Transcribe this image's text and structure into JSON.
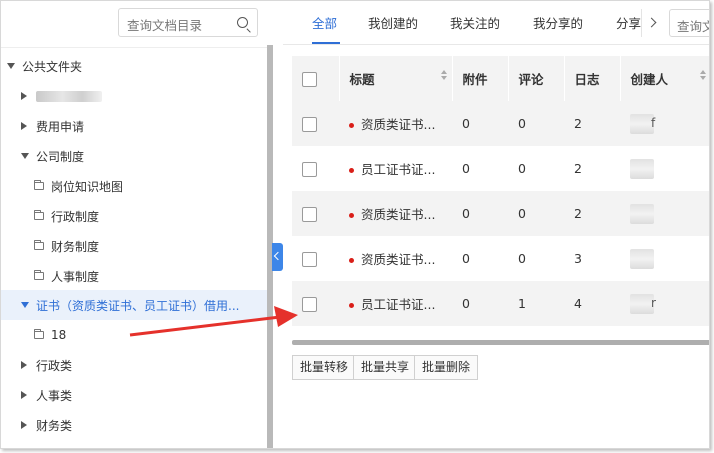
{
  "left_panel": {
    "search_placeholder": "查询文档目录",
    "tree": [
      {
        "label": "公共文件夹",
        "type": "expanded"
      },
      {
        "label": "",
        "type": "collapsed-redacted"
      },
      {
        "label": "费用申请",
        "type": "collapsed"
      },
      {
        "label": "公司制度",
        "type": "expanded"
      },
      {
        "label": "岗位知识地图",
        "type": "folder"
      },
      {
        "label": "行政制度",
        "type": "folder"
      },
      {
        "label": "财务制度",
        "type": "folder"
      },
      {
        "label": "人事制度",
        "type": "folder"
      },
      {
        "label": "证书（资质类证书、员工证书）借用...",
        "type": "expanded-selected"
      },
      {
        "label": "18",
        "type": "folder"
      },
      {
        "label": "行政类",
        "type": "collapsed"
      },
      {
        "label": "人事类",
        "type": "collapsed"
      },
      {
        "label": "财务类",
        "type": "collapsed"
      }
    ]
  },
  "tabs": [
    "全部",
    "我创建的",
    "我关注的",
    "我分享的",
    "分享"
  ],
  "right_search_placeholder": "查询文",
  "table": {
    "headers": [
      "",
      "标题",
      "附件",
      "评论",
      "日志",
      "创建人"
    ],
    "rows": [
      {
        "title": "资质类证书...",
        "attach": "0",
        "comment": "0",
        "log": "2",
        "creator": "f"
      },
      {
        "title": "员工证书证...",
        "attach": "0",
        "comment": "0",
        "log": "2",
        "creator": ""
      },
      {
        "title": "资质类证书...",
        "attach": "0",
        "comment": "0",
        "log": "2",
        "creator": ""
      },
      {
        "title": "资质类证书...",
        "attach": "0",
        "comment": "0",
        "log": "3",
        "creator": ""
      },
      {
        "title": "员工证书证...",
        "attach": "0",
        "comment": "1",
        "log": "4",
        "creator": "r"
      }
    ]
  },
  "batch_buttons": [
    "批量转移",
    "批量共享",
    "批量删除"
  ],
  "colors": {
    "accent": "#2f6fd6",
    "arrow": "#e5312b",
    "status_dot": "#d91e18"
  }
}
